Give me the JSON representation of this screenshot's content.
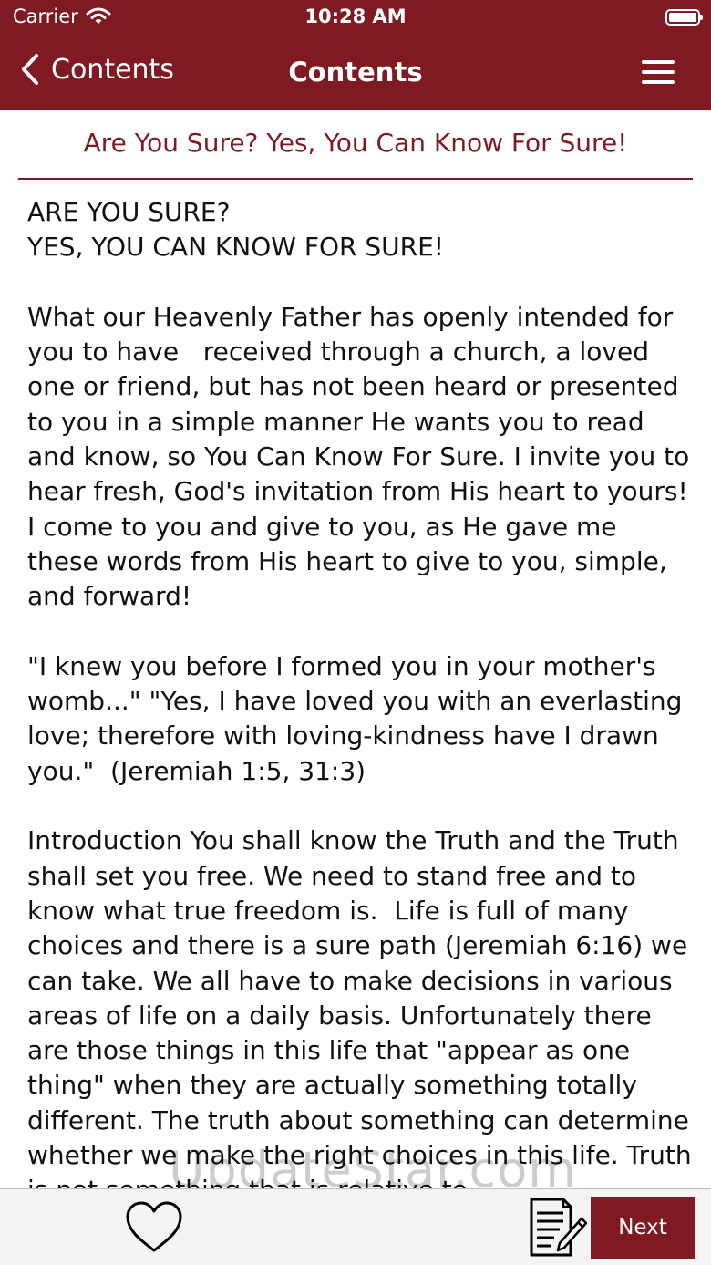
{
  "status_bar": {
    "carrier": "Carrier",
    "time": "10:28 AM"
  },
  "nav": {
    "back_label": "Contents",
    "title": "Contents"
  },
  "section": {
    "title": "Are You Sure? Yes, You Can Know For Sure!"
  },
  "content": {
    "body": "ARE YOU SURE?\nYES, YOU CAN KNOW FOR SURE!\n\nWhat our Heavenly Father has openly intended for you to have   received through a church, a loved one or friend, but has not been heard or presented to you in a simple manner He wants you to read and know, so You Can Know For Sure. I invite you to hear fresh, God's invitation from His heart to yours!  I come to you and give to you, as He gave me these words from His heart to give to you, simple, and forward!\n\n\"I knew you before I formed you in your mother's womb...\" \"Yes, I have loved you with an everlasting love; therefore with loving-kindness have I drawn you.\"  (Jeremiah 1:5, 31:3)\n\nIntroduction You shall know the Truth and the Truth shall set you free. We need to stand free and to know what true freedom is.  Life is full of many choices and there is a sure path (Jeremiah 6:16) we can take. We all have to make decisions in various areas of life on a daily basis. Unfortunately there are those things in this life that \"appear as one thing\" when they are actually something totally different. The truth about something can determine whether we make the right choices in this life. Truth is not something that is relative to"
  },
  "watermark": "UpdateStar.com",
  "bottom_bar": {
    "next_label": "Next"
  },
  "colors": {
    "brand": "#7f1a22",
    "text": "#111111",
    "toolbar_bg": "#f4f4f4"
  },
  "icons": {
    "wifi": "wifi-icon",
    "battery": "battery-icon",
    "back": "chevron-left-icon",
    "menu": "hamburger-menu-icon",
    "favorite": "heart-icon",
    "notes": "notes-edit-icon"
  }
}
